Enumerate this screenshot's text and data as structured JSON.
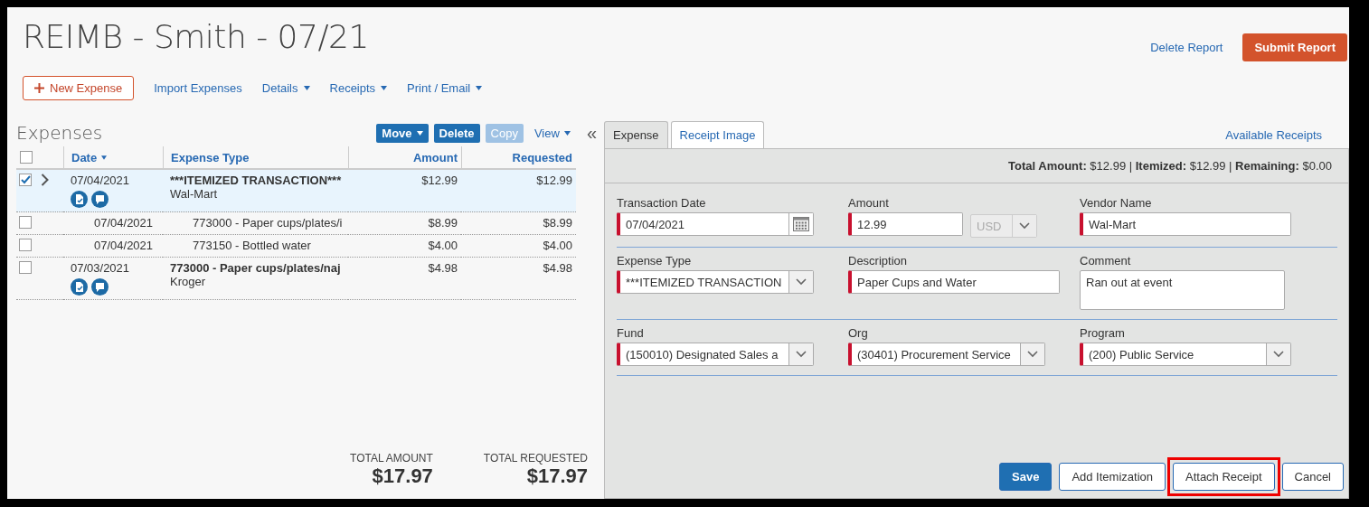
{
  "title": "REIMB - Smith - 07/21",
  "header_actions": [
    {
      "label": "Delete Report",
      "kind": "link"
    },
    {
      "label": "Submit Report",
      "kind": "primary"
    }
  ],
  "toolbar": [
    {
      "label": "New Expense",
      "kind": "add"
    },
    {
      "label": "Import Expenses",
      "kind": "link"
    },
    {
      "label": "Details",
      "kind": "dropdown"
    },
    {
      "label": "Receipts",
      "kind": "dropdown"
    },
    {
      "label": "Print / Email",
      "kind": "dropdown"
    }
  ],
  "expenses": {
    "title": "Expenses",
    "actions": [
      {
        "label": "Move",
        "kind": "dropdown-button",
        "disabled": false
      },
      {
        "label": "Delete",
        "kind": "button",
        "disabled": false
      },
      {
        "label": "Copy",
        "kind": "button",
        "disabled": true
      },
      {
        "label": "View",
        "kind": "dropdown-link",
        "disabled": false
      }
    ],
    "select_all_checked": false,
    "collapse": "«",
    "columns": [
      {
        "label": "Date",
        "sorted": true
      },
      {
        "label": "Expense Type",
        "sorted": false
      },
      {
        "label": "Amount",
        "sorted": false
      },
      {
        "label": "Requested",
        "sorted": false
      }
    ],
    "rows": [
      {
        "kind": "parent",
        "checked": true,
        "selected": true,
        "expandable": true,
        "date": "07/04/2021",
        "type": "***ITEMIZED TRANSACTION***",
        "vendor": "Wal-Mart",
        "amount": "$12.99",
        "requested": "$12.99",
        "has_receipt": true,
        "has_comment": true
      },
      {
        "kind": "child",
        "checked": false,
        "selected": false,
        "expandable": false,
        "date": "07/04/2021",
        "type": "773000 - Paper cups/plates/i",
        "amount": "$8.99",
        "requested": "$8.99",
        "has_receipt": false,
        "has_comment": false
      },
      {
        "kind": "child",
        "checked": false,
        "selected": false,
        "expandable": false,
        "date": "07/04/2021",
        "type": "773150 - Bottled water",
        "amount": "$4.00",
        "requested": "$4.00",
        "has_receipt": false,
        "has_comment": false
      },
      {
        "kind": "parent",
        "checked": false,
        "selected": false,
        "expandable": false,
        "date": "07/03/2021",
        "type": "773000 - Paper cups/plates/naj",
        "vendor": "Kroger",
        "amount": "$4.98",
        "requested": "$4.98",
        "has_receipt": true,
        "has_comment": true
      }
    ],
    "totals": [
      {
        "label": "TOTAL AMOUNT",
        "value": "$17.97"
      },
      {
        "label": "TOTAL REQUESTED",
        "value": "$17.97"
      }
    ]
  },
  "detail": {
    "tabs": [
      {
        "label": "Expense",
        "selected": true
      },
      {
        "label": "Receipt Image",
        "selected": false
      }
    ],
    "link": "Available Receipts",
    "summary": "**Total Amount:** $12.99 | **Itemized:** $12.99 | **Remaining:** $0.00",
    "rows": [
      [
        {
          "label": "Transaction Date",
          "kind": "date",
          "value": "07/04/2021",
          "required": true
        },
        {
          "label": "Amount",
          "kind": "amount",
          "value": "12.99",
          "currency": "USD",
          "required": true
        },
        {
          "label": "Vendor Name",
          "kind": "text",
          "value": "Wal-Mart",
          "required": true
        }
      ],
      [
        {
          "label": "Expense Type",
          "kind": "select",
          "value": "***ITEMIZED TRANSACTION",
          "required": true
        },
        {
          "label": "Description",
          "kind": "text",
          "value": "Paper Cups and Water",
          "required": true
        },
        {
          "label": "Comment",
          "kind": "textarea",
          "value": "Ran out at event",
          "required": false
        }
      ],
      [
        {
          "label": "Fund",
          "kind": "select",
          "value": "(150010) Designated Sales a",
          "required": true
        },
        {
          "label": "Org",
          "kind": "select",
          "value": "(30401) Procurement Service",
          "required": true
        },
        {
          "label": "Program",
          "kind": "select-wide",
          "value": "(200) Public Service",
          "required": true
        }
      ]
    ],
    "buttons": [
      {
        "label": "Save",
        "kind": "primary",
        "highlighted": false
      },
      {
        "label": "Add Itemization",
        "kind": "secondary",
        "highlighted": false
      },
      {
        "label": "Attach Receipt",
        "kind": "secondary",
        "highlighted": true
      },
      {
        "label": "Cancel",
        "kind": "secondary",
        "highlighted": false
      }
    ]
  }
}
